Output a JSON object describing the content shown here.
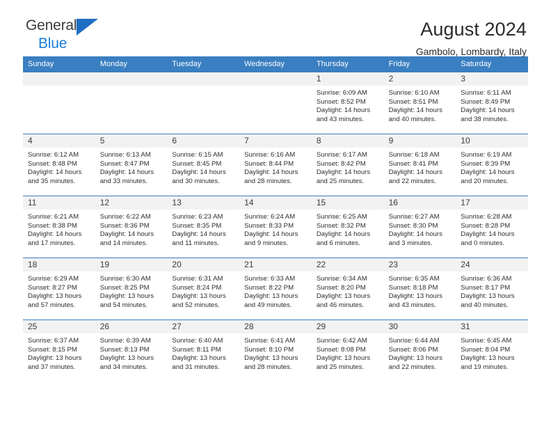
{
  "brand": {
    "word1": "General",
    "word2": "Blue",
    "triangle_color": "#1e6fc4",
    "blue_color": "#1b7ed6"
  },
  "header": {
    "title": "August 2024",
    "subtitle": "Gambolo, Lombardy, Italy"
  },
  "theme": {
    "header_band": "#3a7fc1",
    "daynum_band": "#f2f2f2",
    "text": "#2e2e2e"
  },
  "weekdays": [
    "Sunday",
    "Monday",
    "Tuesday",
    "Wednesday",
    "Thursday",
    "Friday",
    "Saturday"
  ],
  "weeks": [
    [
      {
        "day": "",
        "lines": []
      },
      {
        "day": "",
        "lines": []
      },
      {
        "day": "",
        "lines": []
      },
      {
        "day": "",
        "lines": []
      },
      {
        "day": "1",
        "lines": [
          "Sunrise: 6:09 AM",
          "Sunset: 8:52 PM",
          "Daylight: 14 hours",
          "and 43 minutes."
        ]
      },
      {
        "day": "2",
        "lines": [
          "Sunrise: 6:10 AM",
          "Sunset: 8:51 PM",
          "Daylight: 14 hours",
          "and 40 minutes."
        ]
      },
      {
        "day": "3",
        "lines": [
          "Sunrise: 6:11 AM",
          "Sunset: 8:49 PM",
          "Daylight: 14 hours",
          "and 38 minutes."
        ]
      }
    ],
    [
      {
        "day": "4",
        "lines": [
          "Sunrise: 6:12 AM",
          "Sunset: 8:48 PM",
          "Daylight: 14 hours",
          "and 35 minutes."
        ]
      },
      {
        "day": "5",
        "lines": [
          "Sunrise: 6:13 AM",
          "Sunset: 8:47 PM",
          "Daylight: 14 hours",
          "and 33 minutes."
        ]
      },
      {
        "day": "6",
        "lines": [
          "Sunrise: 6:15 AM",
          "Sunset: 8:45 PM",
          "Daylight: 14 hours",
          "and 30 minutes."
        ]
      },
      {
        "day": "7",
        "lines": [
          "Sunrise: 6:16 AM",
          "Sunset: 8:44 PM",
          "Daylight: 14 hours",
          "and 28 minutes."
        ]
      },
      {
        "day": "8",
        "lines": [
          "Sunrise: 6:17 AM",
          "Sunset: 8:42 PM",
          "Daylight: 14 hours",
          "and 25 minutes."
        ]
      },
      {
        "day": "9",
        "lines": [
          "Sunrise: 6:18 AM",
          "Sunset: 8:41 PM",
          "Daylight: 14 hours",
          "and 22 minutes."
        ]
      },
      {
        "day": "10",
        "lines": [
          "Sunrise: 6:19 AM",
          "Sunset: 8:39 PM",
          "Daylight: 14 hours",
          "and 20 minutes."
        ]
      }
    ],
    [
      {
        "day": "11",
        "lines": [
          "Sunrise: 6:21 AM",
          "Sunset: 8:38 PM",
          "Daylight: 14 hours",
          "and 17 minutes."
        ]
      },
      {
        "day": "12",
        "lines": [
          "Sunrise: 6:22 AM",
          "Sunset: 8:36 PM",
          "Daylight: 14 hours",
          "and 14 minutes."
        ]
      },
      {
        "day": "13",
        "lines": [
          "Sunrise: 6:23 AM",
          "Sunset: 8:35 PM",
          "Daylight: 14 hours",
          "and 11 minutes."
        ]
      },
      {
        "day": "14",
        "lines": [
          "Sunrise: 6:24 AM",
          "Sunset: 8:33 PM",
          "Daylight: 14 hours",
          "and 9 minutes."
        ]
      },
      {
        "day": "15",
        "lines": [
          "Sunrise: 6:25 AM",
          "Sunset: 8:32 PM",
          "Daylight: 14 hours",
          "and 6 minutes."
        ]
      },
      {
        "day": "16",
        "lines": [
          "Sunrise: 6:27 AM",
          "Sunset: 8:30 PM",
          "Daylight: 14 hours",
          "and 3 minutes."
        ]
      },
      {
        "day": "17",
        "lines": [
          "Sunrise: 6:28 AM",
          "Sunset: 8:28 PM",
          "Daylight: 14 hours",
          "and 0 minutes."
        ]
      }
    ],
    [
      {
        "day": "18",
        "lines": [
          "Sunrise: 6:29 AM",
          "Sunset: 8:27 PM",
          "Daylight: 13 hours",
          "and 57 minutes."
        ]
      },
      {
        "day": "19",
        "lines": [
          "Sunrise: 6:30 AM",
          "Sunset: 8:25 PM",
          "Daylight: 13 hours",
          "and 54 minutes."
        ]
      },
      {
        "day": "20",
        "lines": [
          "Sunrise: 6:31 AM",
          "Sunset: 8:24 PM",
          "Daylight: 13 hours",
          "and 52 minutes."
        ]
      },
      {
        "day": "21",
        "lines": [
          "Sunrise: 6:33 AM",
          "Sunset: 8:22 PM",
          "Daylight: 13 hours",
          "and 49 minutes."
        ]
      },
      {
        "day": "22",
        "lines": [
          "Sunrise: 6:34 AM",
          "Sunset: 8:20 PM",
          "Daylight: 13 hours",
          "and 46 minutes."
        ]
      },
      {
        "day": "23",
        "lines": [
          "Sunrise: 6:35 AM",
          "Sunset: 8:18 PM",
          "Daylight: 13 hours",
          "and 43 minutes."
        ]
      },
      {
        "day": "24",
        "lines": [
          "Sunrise: 6:36 AM",
          "Sunset: 8:17 PM",
          "Daylight: 13 hours",
          "and 40 minutes."
        ]
      }
    ],
    [
      {
        "day": "25",
        "lines": [
          "Sunrise: 6:37 AM",
          "Sunset: 8:15 PM",
          "Daylight: 13 hours",
          "and 37 minutes."
        ]
      },
      {
        "day": "26",
        "lines": [
          "Sunrise: 6:39 AM",
          "Sunset: 8:13 PM",
          "Daylight: 13 hours",
          "and 34 minutes."
        ]
      },
      {
        "day": "27",
        "lines": [
          "Sunrise: 6:40 AM",
          "Sunset: 8:11 PM",
          "Daylight: 13 hours",
          "and 31 minutes."
        ]
      },
      {
        "day": "28",
        "lines": [
          "Sunrise: 6:41 AM",
          "Sunset: 8:10 PM",
          "Daylight: 13 hours",
          "and 28 minutes."
        ]
      },
      {
        "day": "29",
        "lines": [
          "Sunrise: 6:42 AM",
          "Sunset: 8:08 PM",
          "Daylight: 13 hours",
          "and 25 minutes."
        ]
      },
      {
        "day": "30",
        "lines": [
          "Sunrise: 6:44 AM",
          "Sunset: 8:06 PM",
          "Daylight: 13 hours",
          "and 22 minutes."
        ]
      },
      {
        "day": "31",
        "lines": [
          "Sunrise: 6:45 AM",
          "Sunset: 8:04 PM",
          "Daylight: 13 hours",
          "and 19 minutes."
        ]
      }
    ]
  ]
}
